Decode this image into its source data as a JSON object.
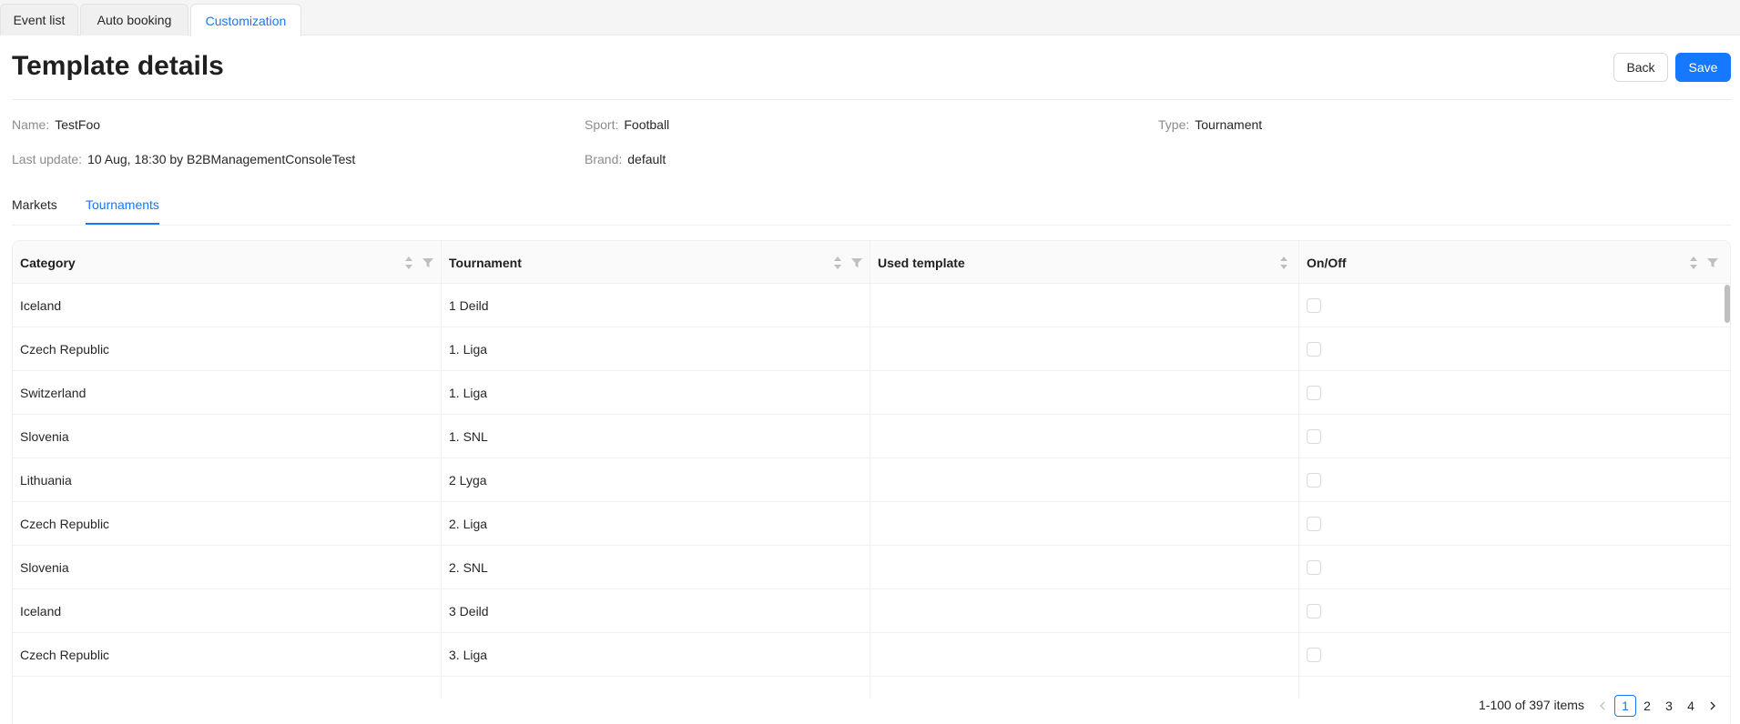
{
  "top_tabs": [
    {
      "label": "Event list"
    },
    {
      "label": "Auto booking"
    },
    {
      "label": "Customization"
    }
  ],
  "header": {
    "title": "Template details",
    "back_label": "Back",
    "save_label": "Save"
  },
  "fields": {
    "name_label": "Name",
    "name_value": "TestFoo",
    "sport_label": "Sport",
    "sport_value": "Football",
    "type_label": "Type",
    "type_value": "Tournament",
    "last_update_label": "Last update",
    "last_update_value": "10 Aug, 18:30 by B2BManagementConsoleTest",
    "brand_label": "Brand",
    "brand_value": "default"
  },
  "inner_tabs": [
    {
      "label": "Markets"
    },
    {
      "label": "Tournaments"
    }
  ],
  "table": {
    "columns": [
      "Category",
      "Tournament",
      "Used template",
      "On/Off"
    ],
    "rows": [
      {
        "category": "Iceland",
        "tournament": "1 Deild",
        "used_template": "",
        "on": false
      },
      {
        "category": "Czech Republic",
        "tournament": "1. Liga",
        "used_template": "",
        "on": false
      },
      {
        "category": "Switzerland",
        "tournament": "1. Liga",
        "used_template": "",
        "on": false
      },
      {
        "category": "Slovenia",
        "tournament": "1. SNL",
        "used_template": "",
        "on": false
      },
      {
        "category": "Lithuania",
        "tournament": "2 Lyga",
        "used_template": "",
        "on": false
      },
      {
        "category": "Czech Republic",
        "tournament": "2. Liga",
        "used_template": "",
        "on": false
      },
      {
        "category": "Slovenia",
        "tournament": "2. SNL",
        "used_template": "",
        "on": false
      },
      {
        "category": "Iceland",
        "tournament": "3 Deild",
        "used_template": "",
        "on": false
      },
      {
        "category": "Czech Republic",
        "tournament": "3. Liga",
        "used_template": "",
        "on": false
      }
    ]
  },
  "pagination": {
    "total_text": "1-100 of 397 items",
    "prev_icon": "chevron-left-icon",
    "next_icon": "chevron-right-icon",
    "pages": [
      "1",
      "2",
      "3",
      "4"
    ],
    "current": "1"
  },
  "colors": {
    "accent": "#1677ff"
  }
}
